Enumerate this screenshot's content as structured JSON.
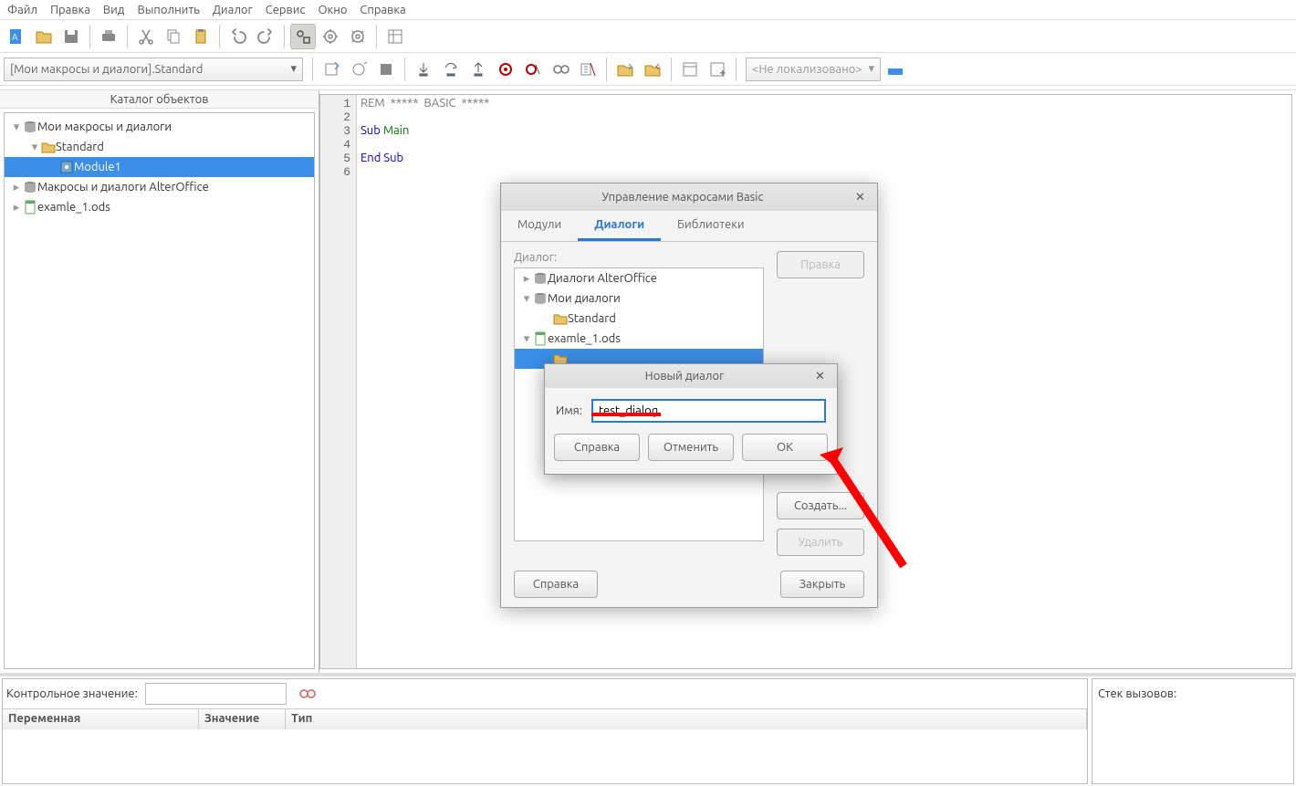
{
  "menu": [
    "Файл",
    "Правка",
    "Вид",
    "Выполнить",
    "Диалог",
    "Сервис",
    "Окно",
    "Справка"
  ],
  "library_selector": "[Мои макросы и диалоги].Standard",
  "locale_box": "<Не локализовано>",
  "catalog": {
    "title": "Каталог объектов",
    "items": [
      {
        "label": "Мои макросы и диалоги",
        "depth": 0,
        "expanded": true,
        "icon": "db"
      },
      {
        "label": "Standard",
        "depth": 1,
        "expanded": true,
        "icon": "folder"
      },
      {
        "label": "Module1",
        "depth": 2,
        "selected": true,
        "icon": "module"
      },
      {
        "label": "Макросы и диалоги AlterOffice",
        "depth": 0,
        "icon": "db"
      },
      {
        "label": "examle_1.ods",
        "depth": 0,
        "icon": "doc"
      }
    ]
  },
  "code": {
    "lines": [
      {
        "n": "1",
        "segs": [
          {
            "t": "REM  *****  BASIC  *****",
            "c": "kw-gray"
          }
        ]
      },
      {
        "n": "2",
        "segs": []
      },
      {
        "n": "3",
        "segs": [
          {
            "t": "Sub ",
            "c": "kw-blue"
          },
          {
            "t": "Main",
            "c": "kw-green"
          }
        ]
      },
      {
        "n": "4",
        "segs": []
      },
      {
        "n": "5",
        "segs": [
          {
            "t": "End Sub",
            "c": "kw-blue"
          }
        ]
      },
      {
        "n": "6",
        "segs": []
      }
    ]
  },
  "watch": {
    "label": "Контрольное значение:",
    "cols": [
      "Переменная",
      "Значение",
      "Тип"
    ]
  },
  "stack": {
    "label": "Стек вызовов:"
  },
  "macro_dialog": {
    "title": "Управление макросами Basic",
    "tabs": [
      "Модули",
      "Диалоги",
      "Библиотеки"
    ],
    "active_tab": 1,
    "tree_label": "Диалог:",
    "tree_items": [
      {
        "label": "Диалоги AlterOffice",
        "depth": 0,
        "icon": "db",
        "exp": "▸"
      },
      {
        "label": "Мои диалоги",
        "depth": 0,
        "icon": "db",
        "exp": "▾"
      },
      {
        "label": "Standard",
        "depth": 1,
        "icon": "folder",
        "exp": ""
      },
      {
        "label": "examle_1.ods",
        "depth": 0,
        "icon": "doc",
        "exp": "▾"
      },
      {
        "label": "",
        "depth": 1,
        "icon": "folder",
        "selected": true,
        "exp": ""
      }
    ],
    "buttons": {
      "edit": "Правка",
      "create": "Создать...",
      "delete": "Удалить"
    },
    "footer": {
      "help": "Справка",
      "close": "Закрыть"
    }
  },
  "new_dialog": {
    "title": "Новый диалог",
    "label": "Имя:",
    "value": "test_dialog",
    "buttons": {
      "help": "Справка",
      "cancel": "Отменить",
      "ok": "ОК"
    }
  }
}
